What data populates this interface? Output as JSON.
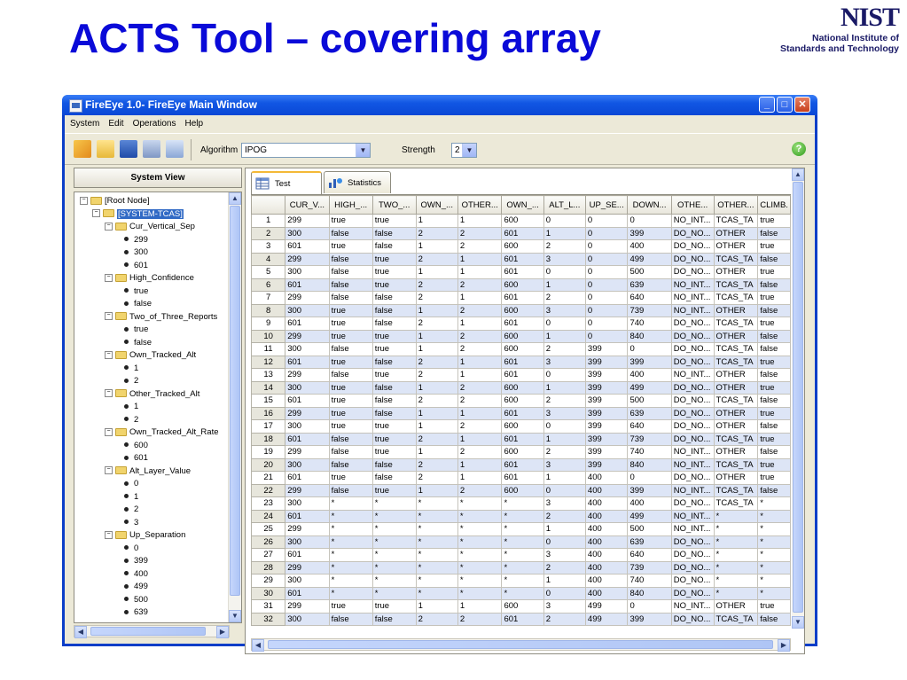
{
  "slide": {
    "title": "ACTS Tool – covering array",
    "logo_mark": "NIST",
    "logo_line1": "National Institute of",
    "logo_line2": "Standards and Technology"
  },
  "window": {
    "title": "FireEye 1.0- FireEye Main Window",
    "menu": [
      "System",
      "Edit",
      "Operations",
      "Help"
    ],
    "algorithm_label": "Algorithm",
    "algorithm_value": "IPOG",
    "strength_label": "Strength",
    "strength_value": "2",
    "system_view_label": "System View",
    "tabs": [
      "Test Result",
      "Statistics"
    ]
  },
  "tree": [
    {
      "label": "[Root Node]",
      "level": 0,
      "type": "folder"
    },
    {
      "label": "[SYSTEM-TCAS]",
      "level": 1,
      "type": "folder",
      "selected": true
    },
    {
      "label": "Cur_Vertical_Sep",
      "level": 2,
      "type": "folder"
    },
    {
      "label": "299",
      "level": 3,
      "type": "leaf"
    },
    {
      "label": "300",
      "level": 3,
      "type": "leaf"
    },
    {
      "label": "601",
      "level": 3,
      "type": "leaf"
    },
    {
      "label": "High_Confidence",
      "level": 2,
      "type": "folder"
    },
    {
      "label": "true",
      "level": 3,
      "type": "leaf"
    },
    {
      "label": "false",
      "level": 3,
      "type": "leaf"
    },
    {
      "label": "Two_of_Three_Reports",
      "level": 2,
      "type": "folder"
    },
    {
      "label": "true",
      "level": 3,
      "type": "leaf"
    },
    {
      "label": "false",
      "level": 3,
      "type": "leaf"
    },
    {
      "label": "Own_Tracked_Alt",
      "level": 2,
      "type": "folder"
    },
    {
      "label": "1",
      "level": 3,
      "type": "leaf"
    },
    {
      "label": "2",
      "level": 3,
      "type": "leaf"
    },
    {
      "label": "Other_Tracked_Alt",
      "level": 2,
      "type": "folder"
    },
    {
      "label": "1",
      "level": 3,
      "type": "leaf"
    },
    {
      "label": "2",
      "level": 3,
      "type": "leaf"
    },
    {
      "label": "Own_Tracked_Alt_Rate",
      "level": 2,
      "type": "folder"
    },
    {
      "label": "600",
      "level": 3,
      "type": "leaf"
    },
    {
      "label": "601",
      "level": 3,
      "type": "leaf"
    },
    {
      "label": "Alt_Layer_Value",
      "level": 2,
      "type": "folder"
    },
    {
      "label": "0",
      "level": 3,
      "type": "leaf"
    },
    {
      "label": "1",
      "level": 3,
      "type": "leaf"
    },
    {
      "label": "2",
      "level": 3,
      "type": "leaf"
    },
    {
      "label": "3",
      "level": 3,
      "type": "leaf"
    },
    {
      "label": "Up_Separation",
      "level": 2,
      "type": "folder"
    },
    {
      "label": "0",
      "level": 3,
      "type": "leaf"
    },
    {
      "label": "399",
      "level": 3,
      "type": "leaf"
    },
    {
      "label": "400",
      "level": 3,
      "type": "leaf"
    },
    {
      "label": "499",
      "level": 3,
      "type": "leaf"
    },
    {
      "label": "500",
      "level": 3,
      "type": "leaf"
    },
    {
      "label": "639",
      "level": 3,
      "type": "leaf"
    }
  ],
  "table": {
    "headers": [
      "",
      "CUR_V...",
      "HIGH_...",
      "TWO_...",
      "OWN_...",
      "OTHER...",
      "OWN_...",
      "ALT_L...",
      "UP_SE...",
      "DOWN...",
      "OTHE...",
      "OTHER...",
      "CLIMB."
    ],
    "rows": [
      [
        "1",
        "299",
        "true",
        "true",
        "1",
        "1",
        "600",
        "0",
        "0",
        "0",
        "NO_INT...",
        "TCAS_TA",
        "true"
      ],
      [
        "2",
        "300",
        "false",
        "false",
        "2",
        "2",
        "601",
        "1",
        "0",
        "399",
        "DO_NO...",
        "OTHER",
        "false"
      ],
      [
        "3",
        "601",
        "true",
        "false",
        "1",
        "2",
        "600",
        "2",
        "0",
        "400",
        "DO_NO...",
        "OTHER",
        "true"
      ],
      [
        "4",
        "299",
        "false",
        "true",
        "2",
        "1",
        "601",
        "3",
        "0",
        "499",
        "DO_NO...",
        "TCAS_TA",
        "false"
      ],
      [
        "5",
        "300",
        "false",
        "true",
        "1",
        "1",
        "601",
        "0",
        "0",
        "500",
        "DO_NO...",
        "OTHER",
        "true"
      ],
      [
        "6",
        "601",
        "false",
        "true",
        "2",
        "2",
        "600",
        "1",
        "0",
        "639",
        "NO_INT...",
        "TCAS_TA",
        "false"
      ],
      [
        "7",
        "299",
        "false",
        "false",
        "2",
        "1",
        "601",
        "2",
        "0",
        "640",
        "NO_INT...",
        "TCAS_TA",
        "true"
      ],
      [
        "8",
        "300",
        "true",
        "false",
        "1",
        "2",
        "600",
        "3",
        "0",
        "739",
        "NO_INT...",
        "OTHER",
        "false"
      ],
      [
        "9",
        "601",
        "true",
        "false",
        "2",
        "1",
        "601",
        "0",
        "0",
        "740",
        "DO_NO...",
        "TCAS_TA",
        "true"
      ],
      [
        "10",
        "299",
        "true",
        "true",
        "1",
        "2",
        "600",
        "1",
        "0",
        "840",
        "DO_NO...",
        "OTHER",
        "false"
      ],
      [
        "11",
        "300",
        "false",
        "true",
        "1",
        "2",
        "600",
        "2",
        "399",
        "0",
        "DO_NO...",
        "TCAS_TA",
        "false"
      ],
      [
        "12",
        "601",
        "true",
        "false",
        "2",
        "1",
        "601",
        "3",
        "399",
        "399",
        "DO_NO...",
        "TCAS_TA",
        "true"
      ],
      [
        "13",
        "299",
        "false",
        "true",
        "2",
        "1",
        "601",
        "0",
        "399",
        "400",
        "NO_INT...",
        "OTHER",
        "false"
      ],
      [
        "14",
        "300",
        "true",
        "false",
        "1",
        "2",
        "600",
        "1",
        "399",
        "499",
        "DO_NO...",
        "OTHER",
        "true"
      ],
      [
        "15",
        "601",
        "true",
        "false",
        "2",
        "2",
        "600",
        "2",
        "399",
        "500",
        "DO_NO...",
        "TCAS_TA",
        "false"
      ],
      [
        "16",
        "299",
        "true",
        "false",
        "1",
        "1",
        "601",
        "3",
        "399",
        "639",
        "DO_NO...",
        "OTHER",
        "true"
      ],
      [
        "17",
        "300",
        "true",
        "true",
        "1",
        "2",
        "600",
        "0",
        "399",
        "640",
        "DO_NO...",
        "OTHER",
        "false"
      ],
      [
        "18",
        "601",
        "false",
        "true",
        "2",
        "1",
        "601",
        "1",
        "399",
        "739",
        "DO_NO...",
        "TCAS_TA",
        "true"
      ],
      [
        "19",
        "299",
        "false",
        "true",
        "1",
        "2",
        "600",
        "2",
        "399",
        "740",
        "NO_INT...",
        "OTHER",
        "false"
      ],
      [
        "20",
        "300",
        "false",
        "false",
        "2",
        "1",
        "601",
        "3",
        "399",
        "840",
        "NO_INT...",
        "TCAS_TA",
        "true"
      ],
      [
        "21",
        "601",
        "true",
        "false",
        "2",
        "1",
        "601",
        "1",
        "400",
        "0",
        "DO_NO...",
        "OTHER",
        "true"
      ],
      [
        "22",
        "299",
        "false",
        "true",
        "1",
        "2",
        "600",
        "0",
        "400",
        "399",
        "NO_INT...",
        "TCAS_TA",
        "false"
      ],
      [
        "23",
        "300",
        "*",
        "*",
        "*",
        "*",
        "*",
        "3",
        "400",
        "400",
        "DO_NO...",
        "TCAS_TA",
        "*"
      ],
      [
        "24",
        "601",
        "*",
        "*",
        "*",
        "*",
        "*",
        "2",
        "400",
        "499",
        "NO_INT...",
        "*",
        "*"
      ],
      [
        "25",
        "299",
        "*",
        "*",
        "*",
        "*",
        "*",
        "1",
        "400",
        "500",
        "NO_INT...",
        "*",
        "*"
      ],
      [
        "26",
        "300",
        "*",
        "*",
        "*",
        "*",
        "*",
        "0",
        "400",
        "639",
        "DO_NO...",
        "*",
        "*"
      ],
      [
        "27",
        "601",
        "*",
        "*",
        "*",
        "*",
        "*",
        "3",
        "400",
        "640",
        "DO_NO...",
        "*",
        "*"
      ],
      [
        "28",
        "299",
        "*",
        "*",
        "*",
        "*",
        "*",
        "2",
        "400",
        "739",
        "DO_NO...",
        "*",
        "*"
      ],
      [
        "29",
        "300",
        "*",
        "*",
        "*",
        "*",
        "*",
        "1",
        "400",
        "740",
        "DO_NO...",
        "*",
        "*"
      ],
      [
        "30",
        "601",
        "*",
        "*",
        "*",
        "*",
        "*",
        "0",
        "400",
        "840",
        "DO_NO...",
        "*",
        "*"
      ],
      [
        "31",
        "299",
        "true",
        "true",
        "1",
        "1",
        "600",
        "3",
        "499",
        "0",
        "NO_INT...",
        "OTHER",
        "true"
      ],
      [
        "32",
        "300",
        "false",
        "false",
        "2",
        "2",
        "601",
        "2",
        "499",
        "399",
        "DO_NO...",
        "TCAS_TA",
        "false"
      ]
    ]
  }
}
